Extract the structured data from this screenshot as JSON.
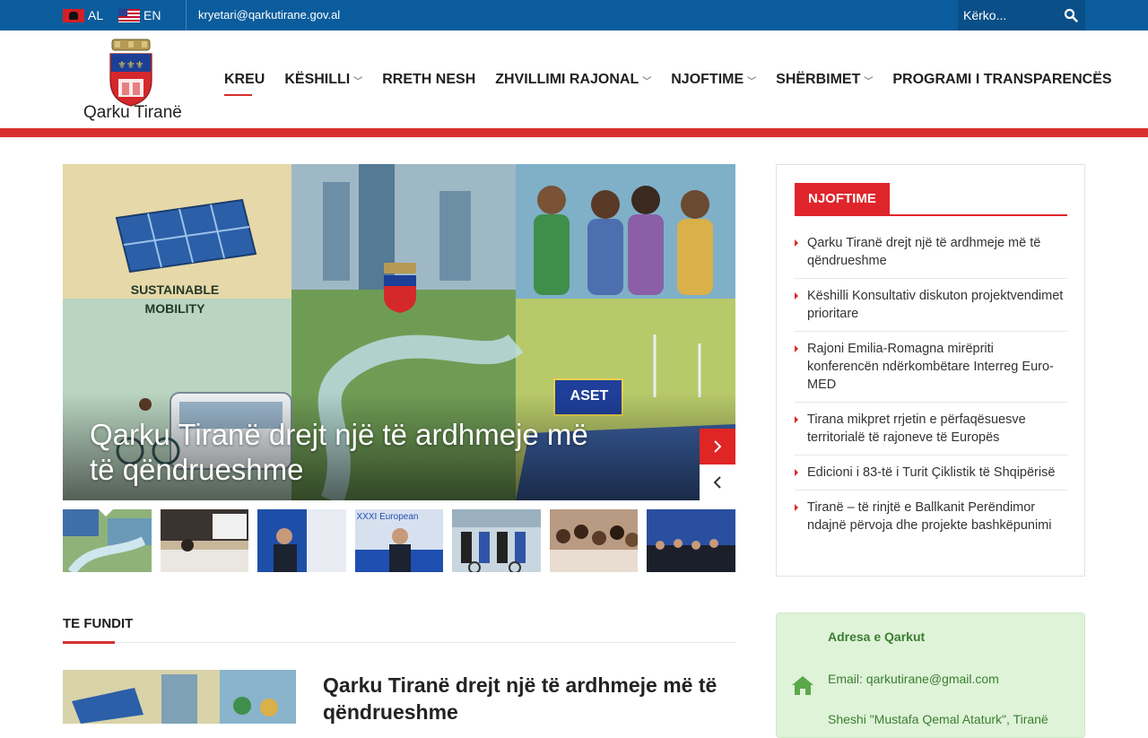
{
  "topbar": {
    "lang_al": "AL",
    "lang_en": "EN",
    "email": "kryetari@qarkutirane.gov.al",
    "search_placeholder": "Kërko..."
  },
  "header": {
    "logo_text": "Qarku Tiranë",
    "nav": [
      {
        "label": "KREU",
        "dropdown": false,
        "active": true
      },
      {
        "label": "KËSHILLI",
        "dropdown": true
      },
      {
        "label": "RRETH NESH",
        "dropdown": false
      },
      {
        "label": "ZHVILLIMI RAJONAL",
        "dropdown": true
      },
      {
        "label": "NJOFTIME",
        "dropdown": true
      },
      {
        "label": "SHËRBIMET",
        "dropdown": true
      },
      {
        "label": "PROGRAMI I TRANSPARENCËS",
        "dropdown": false
      }
    ]
  },
  "slider": {
    "title": "Qarku Tiranë drejt një të ardhmeje më të qëndrueshme",
    "image_text_1": "SUSTAINABLE MOBILITY",
    "image_text_2": "ASET",
    "thumb_text": "XXXI European",
    "active_thumb": 1
  },
  "latest": {
    "section_title": "TE FUNDIT",
    "headline": "Qarku Tiranë drejt një të ardhmeje më të qëndrueshme"
  },
  "sidebar": {
    "tab_title": "NJOFTIME",
    "items": [
      "Qarku Tiranë drejt një të ardhmeje më të qëndrueshme",
      "Këshilli Konsultativ diskuton projektvendimet prioritare",
      "Rajoni Emilia-Romagna mirëpriti konferencën ndërkombëtare Interreg Euro-MED",
      "Tirana mikpret rrjetin e përfaqësuesve territorialë të rajoneve të Europës",
      "Edicioni i 83-të i Turit Çiklistik të Shqipërisë",
      "Tiranë – të rinjtë e Ballkanit Perëndimor ndajnë përvoja dhe projekte bashkëpunimi"
    ],
    "address_title": "Adresa e Qarkut",
    "address_email": "Email: qarkutirane@gmail.com",
    "address_street": "Sheshi \"Mustafa Qemal Ataturk\", Tiranë"
  },
  "colors": {
    "topbar": "#0b5c9c",
    "accent_red": "#d92f2f",
    "address_green": "#3b7d30"
  }
}
